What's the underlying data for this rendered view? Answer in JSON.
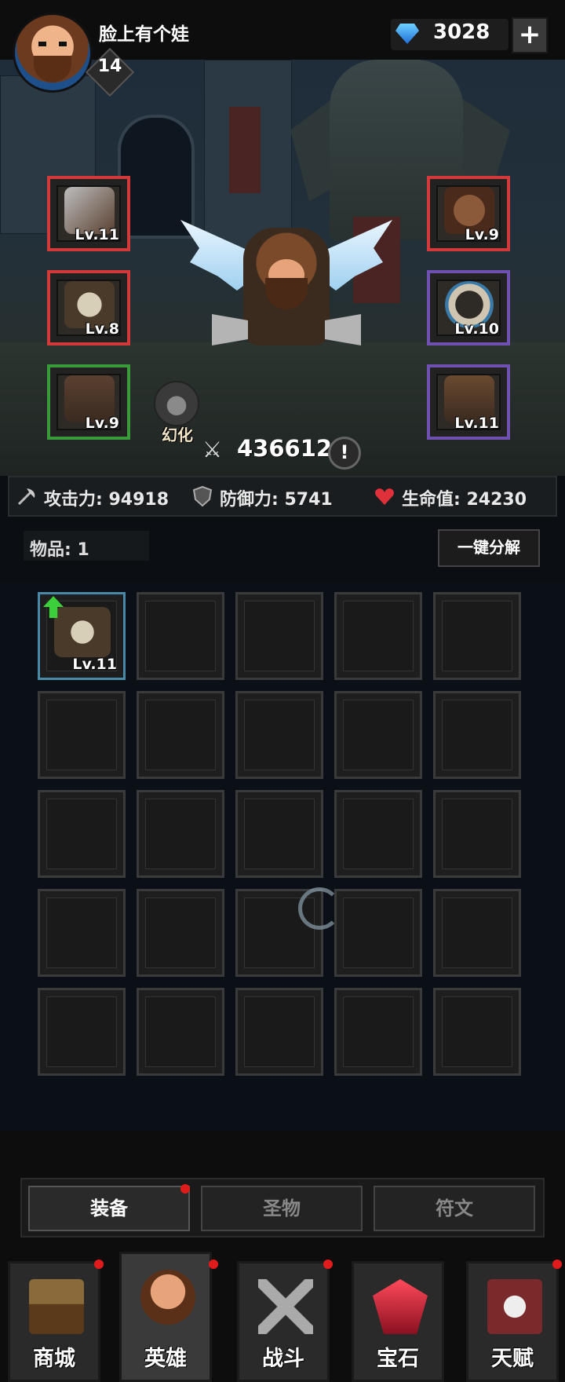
{
  "player": {
    "name": "脸上有个娃",
    "level": "14"
  },
  "currency": {
    "gems": "3028",
    "add_label": "+"
  },
  "equipment": {
    "left": [
      {
        "level": "Lv.11",
        "item": "battle-axe",
        "rarity_color": "#d23a3a"
      },
      {
        "level": "Lv.8",
        "item": "fur-armor",
        "rarity_color": "#d23a3a"
      },
      {
        "level": "Lv.9",
        "item": "fur-pants",
        "rarity_color": "#3a9a3a"
      }
    ],
    "right": [
      {
        "level": "Lv.9",
        "item": "bear-helmet",
        "rarity_color": "#d23a3a"
      },
      {
        "level": "Lv.10",
        "item": "claw-ring",
        "rarity_color": "#7050b0"
      },
      {
        "level": "Lv.11",
        "item": "fur-boots",
        "rarity_color": "#7050b0"
      }
    ]
  },
  "hero": {
    "transform_label": "幻化",
    "power": "436612",
    "info_label": "!"
  },
  "stats": {
    "attack": "攻击力: 94918",
    "defense": "防御力: 5741",
    "health": "生命值: 24230"
  },
  "inventory": {
    "label": "物品: 1",
    "decompose_label": "一键分解",
    "first_item_level": "Lv.11"
  },
  "sub_tabs": {
    "equipment": "装备",
    "relics": "圣物",
    "runes": "符文"
  },
  "nav": {
    "shop": "商城",
    "hero": "英雄",
    "battle": "战斗",
    "gems": "宝石",
    "talents": "天赋"
  },
  "colors": {
    "notify_dot": "#e01b1b",
    "upgrade_arrow": "#3ccf3c"
  }
}
